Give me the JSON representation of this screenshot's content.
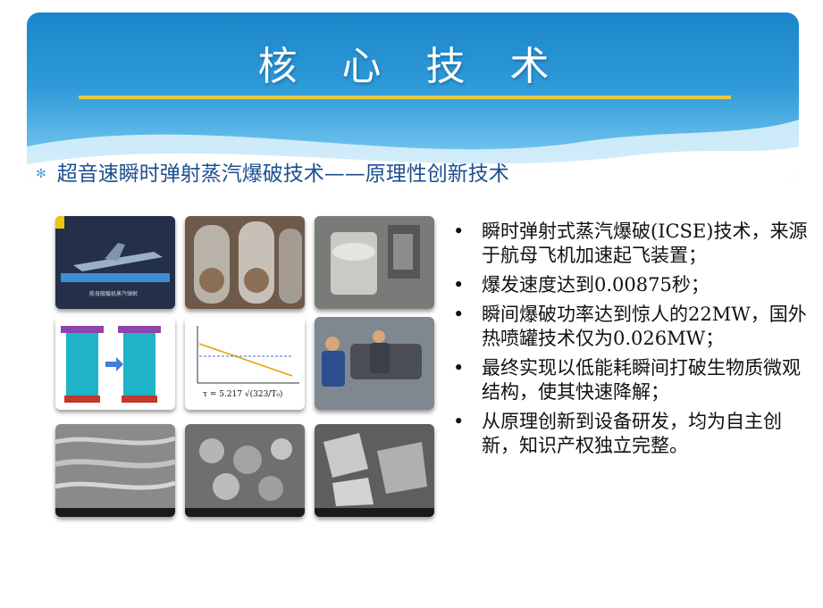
{
  "slide": {
    "title": "核 心 技 术",
    "subtitle_marker": "✻",
    "subtitle": "超音速瞬时弹射蒸汽爆破技术——原理性创新技术"
  },
  "photos": [
    {
      "name": "jet-aircraft-carrier-photo",
      "caption": "航母舰载机蒸汽弹射"
    },
    {
      "name": "steam-pipes-photo"
    },
    {
      "name": "explosion-vessel-photo"
    },
    {
      "name": "cylinder-diagram-photo"
    },
    {
      "name": "formula-chart-photo",
      "formula": "τ = 5.217 √(323/T₀)"
    },
    {
      "name": "workers-equipment-photo"
    },
    {
      "name": "micro-structure-photo-1"
    },
    {
      "name": "micro-structure-photo-2"
    },
    {
      "name": "micro-structure-photo-3"
    }
  ],
  "bullets": [
    "瞬时弹射式蒸汽爆破(ICSE)技术，来源于航母飞机加速起飞装置；",
    "爆发速度达到0.00875秒；",
    "瞬间爆破功率达到惊人的22MW，国外热喷罐技术仅为0.026MW；",
    "最终实现以低能耗瞬间打破生物质微观结构，使其快速降解；",
    "从原理创新到设备研发，均为自主创新，知识产权独立完整。"
  ],
  "colors": {
    "banner": "#2f9bd9",
    "rule": "#e8c840",
    "subtitle": "#1d4f8f"
  }
}
